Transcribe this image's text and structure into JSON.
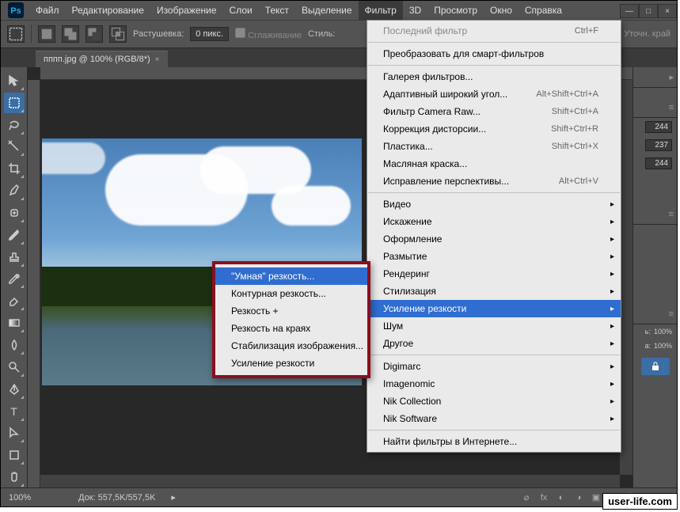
{
  "menubar": {
    "items": [
      "Файл",
      "Редактирование",
      "Изображение",
      "Слои",
      "Текст",
      "Выделение",
      "Фильтр",
      "3D",
      "Просмотр",
      "Окно",
      "Справка"
    ]
  },
  "options": {
    "feather_label": "Растушевка:",
    "feather_value": "0 пикс.",
    "antialias": "Сглаживание",
    "style_label": "Стиль:",
    "refine_edge": "Уточн. край"
  },
  "tab": {
    "title": "пппп.jpg @ 100% (RGB/8*)"
  },
  "filter_menu": {
    "last_filter": {
      "label": "Последний фильтр",
      "shortcut": "Ctrl+F"
    },
    "smart": "Преобразовать для смарт-фильтров",
    "gallery": "Галерея фильтров...",
    "adaptive": {
      "label": "Адаптивный широкий угол...",
      "shortcut": "Alt+Shift+Ctrl+A"
    },
    "camera_raw": {
      "label": "Фильтр Camera Raw...",
      "shortcut": "Shift+Ctrl+A"
    },
    "lens": {
      "label": "Коррекция дисторсии...",
      "shortcut": "Shift+Ctrl+R"
    },
    "liquify": {
      "label": "Пластика...",
      "shortcut": "Shift+Ctrl+X"
    },
    "oil": "Масляная краска...",
    "vanishing": {
      "label": "Исправление перспективы...",
      "shortcut": "Alt+Ctrl+V"
    },
    "groups": [
      "Видео",
      "Искажение",
      "Оформление",
      "Размытие",
      "Рендеринг",
      "Стилизация",
      "Усиление резкости",
      "Шум",
      "Другое"
    ],
    "plugins": [
      "Digimarc",
      "Imagenomic",
      "Nik Collection",
      "Nik Software"
    ],
    "browse": "Найти фильтры в Интернете..."
  },
  "submenu": {
    "items": [
      "\"Умная\" резкость...",
      "Контурная резкость...",
      "Резкость +",
      "Резкость на краях",
      "Стабилизация изображения...",
      "Усиление резкости"
    ]
  },
  "panels": {
    "n1": "244",
    "n2": "237",
    "n3": "244",
    "opacity": "100%",
    "fill": "100%"
  },
  "status": {
    "zoom": "100%",
    "doc": "Док: 557,5K/557,5K"
  },
  "watermark": "user-life.com"
}
